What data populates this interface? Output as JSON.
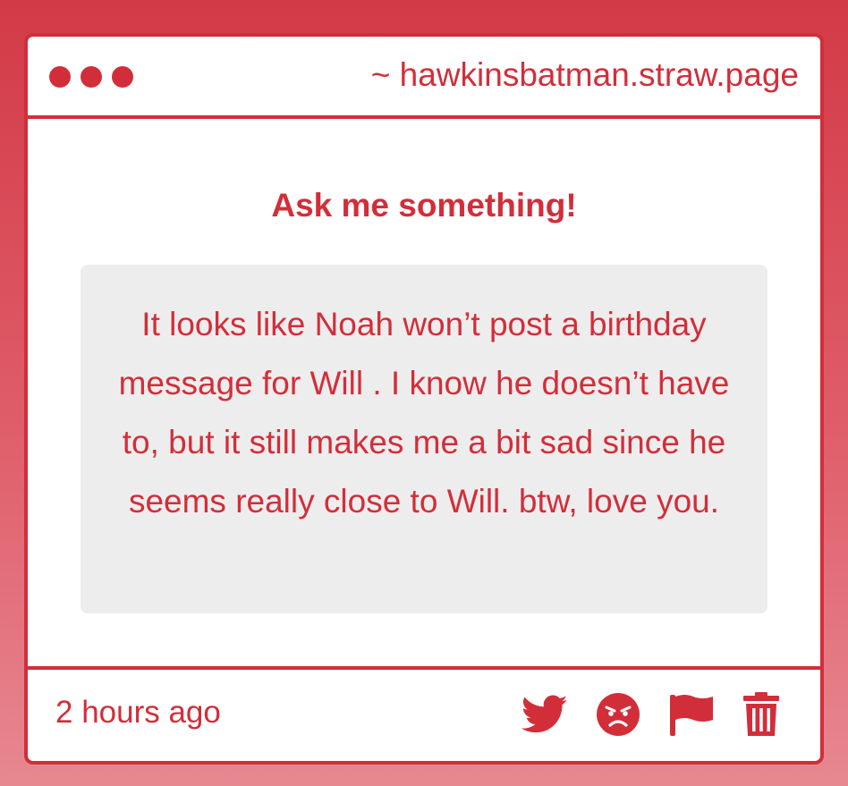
{
  "window": {
    "url": "~ hawkinsbatman.straw.page"
  },
  "content": {
    "heading": "Ask me something!",
    "message": "It looks like Noah won’t post a birthday message for Will . I know he doesn’t have to, but it still makes me a bit sad since he seems really close to Will. btw, love you."
  },
  "footer": {
    "time": "2 hours ago",
    "actions": [
      {
        "name": "twitter-share",
        "icon": "twitter-bird-icon"
      },
      {
        "name": "angry-reaction",
        "icon": "angry-face-icon"
      },
      {
        "name": "report",
        "icon": "flag-icon"
      },
      {
        "name": "delete",
        "icon": "trash-icon"
      }
    ]
  },
  "colors": {
    "accent": "#d22e3a",
    "message_background": "#ededed"
  }
}
